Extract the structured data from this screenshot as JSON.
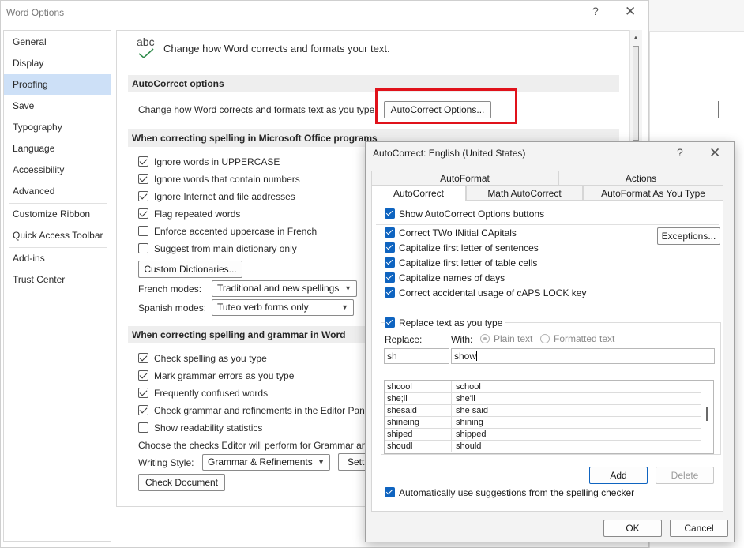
{
  "options_dialog": {
    "title": "Word Options",
    "help_glyph": "?",
    "close_glyph": "✕",
    "nav": [
      "General",
      "Display",
      "Proofing",
      "Save",
      "Typography",
      "Language",
      "Accessibility",
      "Advanced",
      "Customize Ribbon",
      "Quick Access Toolbar",
      "Add-ins",
      "Trust Center"
    ],
    "active_nav": "Proofing",
    "header_icon_text": "abc",
    "header_text": "Change how Word corrects and formats your text.",
    "autocorrect_section": "AutoCorrect options",
    "autocorrect_desc": "Change how Word corrects and formats text as you type:",
    "autocorrect_btn": "AutoCorrect Options...",
    "spelling_section": "When correcting spelling in Microsoft Office programs",
    "spelling_options": [
      {
        "label": "Ignore words in UPPERCASE",
        "checked": true
      },
      {
        "label": "Ignore words that contain numbers",
        "checked": true
      },
      {
        "label": "Ignore Internet and file addresses",
        "checked": true
      },
      {
        "label": "Flag repeated words",
        "checked": true
      },
      {
        "label": "Enforce accented uppercase in French",
        "checked": false
      },
      {
        "label": "Suggest from main dictionary only",
        "checked": false
      }
    ],
    "custom_dict_btn": "Custom Dictionaries...",
    "french_modes_label": "French modes:",
    "french_modes_value": "Traditional and new spellings",
    "spanish_modes_label": "Spanish modes:",
    "spanish_modes_value": "Tuteo verb forms only",
    "grammar_section": "When correcting spelling and grammar in Word",
    "grammar_options": [
      {
        "label": "Check spelling as you type",
        "checked": true
      },
      {
        "label": "Mark grammar errors as you type",
        "checked": true
      },
      {
        "label": "Frequently confused words",
        "checked": true
      },
      {
        "label": "Check grammar and refinements in the Editor Pane",
        "checked": true
      },
      {
        "label": "Show readability statistics",
        "checked": false
      }
    ],
    "choose_checks": "Choose the checks Editor will perform for Grammar and Refinements",
    "writing_style_label": "Writing Style:",
    "writing_style_value": "Grammar & Refinements",
    "settings_btn": "Settings...",
    "check_doc_btn": "Check Document"
  },
  "autocorrect_dialog": {
    "title": "AutoCorrect: English (United States)",
    "help_glyph": "?",
    "close_glyph": "✕",
    "tabs_row1": [
      "AutoFormat",
      "Actions"
    ],
    "tabs_row2": [
      "AutoCorrect",
      "Math AutoCorrect",
      "AutoFormat As You Type"
    ],
    "active_tab": "AutoCorrect",
    "show_buttons": "Show AutoCorrect Options buttons",
    "options": [
      "Correct TWo INitial CApitals",
      "Capitalize first letter of sentences",
      "Capitalize first letter of table cells",
      "Capitalize names of days",
      "Correct accidental usage of cAPS LOCK key"
    ],
    "exceptions_btn": "Exceptions...",
    "replace_as_type": "Replace text as you type",
    "replace_label": "Replace:",
    "with_label": "With:",
    "plain_text": "Plain text",
    "formatted_text": "Formatted text",
    "replace_value": "sh",
    "with_value": "show",
    "entries": [
      {
        "from": "shcool",
        "to": "school"
      },
      {
        "from": "she;ll",
        "to": "she'll"
      },
      {
        "from": "shesaid",
        "to": "she said"
      },
      {
        "from": "shineing",
        "to": "shining"
      },
      {
        "from": "shiped",
        "to": "shipped"
      },
      {
        "from": "shoudl",
        "to": "should"
      }
    ],
    "add_btn": "Add",
    "delete_btn": "Delete",
    "auto_suggest": "Automatically use suggestions from the spelling checker",
    "ok_btn": "OK",
    "cancel_btn": "Cancel"
  },
  "colors": {
    "accent": "#0f64c0",
    "highlight": "#e0121b",
    "nav_active": "#cde0f7"
  }
}
